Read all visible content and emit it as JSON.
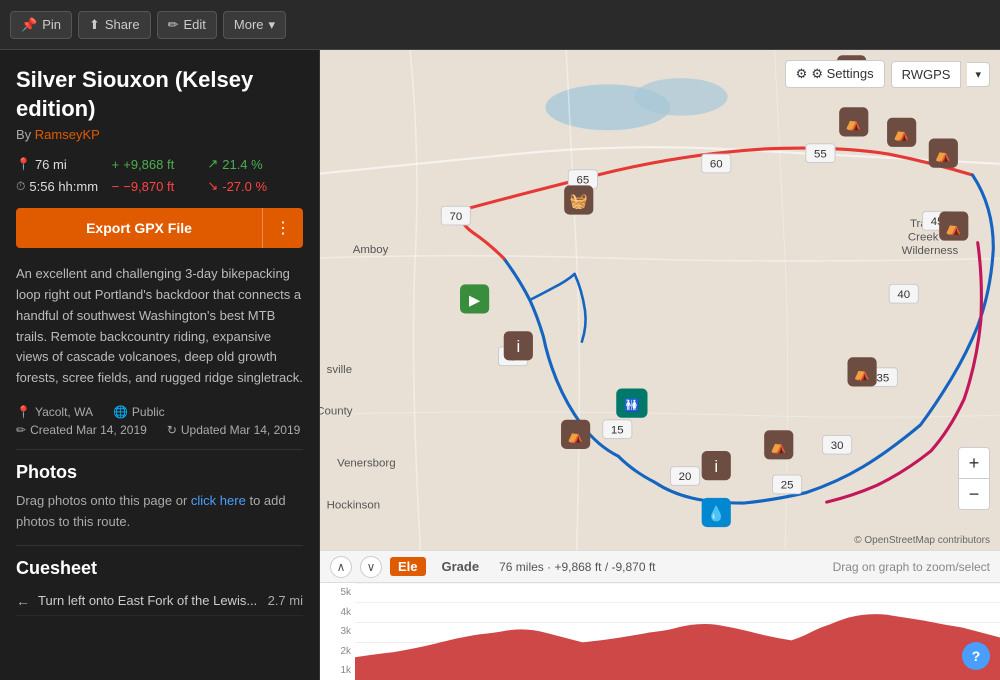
{
  "toolbar": {
    "pin_label": "Pin",
    "share_label": "Share",
    "edit_label": "Edit",
    "more_label": "More",
    "settings_label": "⚙ Settings",
    "rwgps_label": "RWGPS"
  },
  "route": {
    "title": "Silver Siouxon (Kelsey edition)",
    "author_prefix": "By",
    "author_name": "RamseyKP",
    "distance": "76",
    "distance_unit": "mi",
    "elevation_gain": "+9,868",
    "elevation_gain_unit": "ft",
    "climbing_pct": "21.4",
    "climbing_unit": "%",
    "time": "5:56",
    "time_unit": "hh:mm",
    "elevation_loss": "−9,870",
    "elevation_loss_unit": "ft",
    "descent_pct": "-27.0",
    "descent_unit": "%",
    "export_label": "Export GPX File",
    "description": "An excellent and challenging 3-day bikepacking loop right out Portland's backdoor that connects a handful of southwest Washington's best MTB trails. Remote backcountry riding, expansive views of cascade volcanoes, deep old growth forests, scree fields, and rugged ridge singletrack.",
    "location": "Yacolt, WA",
    "visibility": "Public",
    "created": "Created Mar 14, 2019",
    "updated": "Updated Mar 14, 2019"
  },
  "photos": {
    "title": "Photos",
    "drag_text": "Drag photos onto this page or",
    "click_here": "click here",
    "to_add": "to add photos to this route."
  },
  "cuesheet": {
    "title": "Cuesheet",
    "items": [
      {
        "direction": "←",
        "text": "Turn left onto East Fork of the Lewis...",
        "distance": "2.7 mi"
      }
    ]
  },
  "elevation": {
    "ele_label": "Ele",
    "grade_label": "Grade",
    "stats": "76 miles · +9,868 ft / -9,870 ft",
    "hint": "Drag on graph to zoom/select",
    "y_labels": [
      "5k",
      "4k",
      "3k",
      "2k",
      "1k"
    ]
  },
  "map": {
    "attribution": "© OpenStreetMap contributors",
    "zoom_in": "+",
    "zoom_out": "−"
  },
  "help": {
    "label": "?"
  }
}
